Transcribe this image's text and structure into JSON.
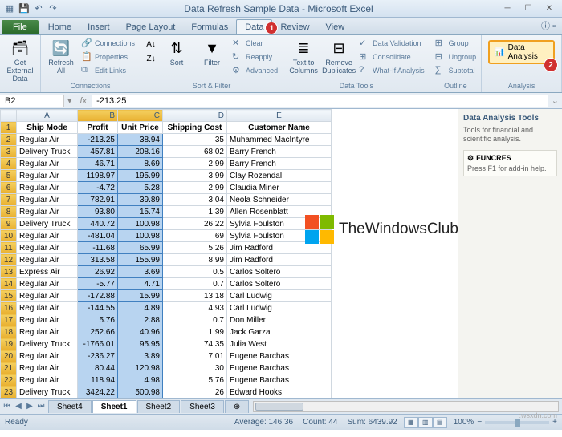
{
  "title": "Data Refresh Sample Data - Microsoft Excel",
  "tabs": {
    "file": "File",
    "home": "Home",
    "insert": "Insert",
    "pagelayout": "Page Layout",
    "formulas": "Formulas",
    "data": "Data",
    "review": "Review",
    "view": "View"
  },
  "badges": {
    "data": "1",
    "analysis": "2"
  },
  "ribbon": {
    "getdata": "Get External Data",
    "refresh": "Refresh All",
    "connections_lbl": "Connections",
    "connections": "Connections",
    "properties": "Properties",
    "editlinks": "Edit Links",
    "sort": "Sort",
    "filter": "Filter",
    "sortfilter": "Sort & Filter",
    "clear": "Clear",
    "reapply": "Reapply",
    "advanced": "Advanced",
    "ttc": "Text to Columns",
    "remdup": "Remove Duplicates",
    "datatools": "Data Tools",
    "validation": "Data Validation",
    "consolidate": "Consolidate",
    "whatif": "What-If Analysis",
    "group": "Group",
    "ungroup": "Ungroup",
    "subtotal": "Subtotal",
    "outline": "Outline",
    "dataanalysis": "Data Analysis",
    "analysis": "Analysis"
  },
  "namebox": "B2",
  "formula": "-213.25",
  "columns": [
    "A",
    "B",
    "C",
    "D",
    "E"
  ],
  "headers": {
    "A": "Ship Mode",
    "B": "Profit",
    "C": "Unit Price",
    "D": "Shipping Cost",
    "E": "Customer Name"
  },
  "rows": [
    {
      "n": "2",
      "A": "Regular Air",
      "B": "-213.25",
      "C": "38.94",
      "D": "35",
      "E": "Muhammed MacIntyre"
    },
    {
      "n": "3",
      "A": "Delivery Truck",
      "B": "457.81",
      "C": "208.16",
      "D": "68.02",
      "E": "Barry French"
    },
    {
      "n": "4",
      "A": "Regular Air",
      "B": "46.71",
      "C": "8.69",
      "D": "2.99",
      "E": "Barry French"
    },
    {
      "n": "5",
      "A": "Regular Air",
      "B": "1198.97",
      "C": "195.99",
      "D": "3.99",
      "E": "Clay Rozendal"
    },
    {
      "n": "6",
      "A": "Regular Air",
      "B": "-4.72",
      "C": "5.28",
      "D": "2.99",
      "E": "Claudia Miner"
    },
    {
      "n": "7",
      "A": "Regular Air",
      "B": "782.91",
      "C": "39.89",
      "D": "3.04",
      "E": "Neola Schneider"
    },
    {
      "n": "8",
      "A": "Regular Air",
      "B": "93.80",
      "C": "15.74",
      "D": "1.39",
      "E": "Allen Rosenblatt"
    },
    {
      "n": "9",
      "A": "Delivery Truck",
      "B": "440.72",
      "C": "100.98",
      "D": "26.22",
      "E": "Sylvia Foulston"
    },
    {
      "n": "10",
      "A": "Regular Air",
      "B": "-481.04",
      "C": "100.98",
      "D": "69",
      "E": "Sylvia Foulston"
    },
    {
      "n": "11",
      "A": "Regular Air",
      "B": "-11.68",
      "C": "65.99",
      "D": "5.26",
      "E": "Jim Radford"
    },
    {
      "n": "12",
      "A": "Regular Air",
      "B": "313.58",
      "C": "155.99",
      "D": "8.99",
      "E": "Jim Radford"
    },
    {
      "n": "13",
      "A": "Express Air",
      "B": "26.92",
      "C": "3.69",
      "D": "0.5",
      "E": "Carlos Soltero"
    },
    {
      "n": "14",
      "A": "Regular Air",
      "B": "-5.77",
      "C": "4.71",
      "D": "0.7",
      "E": "Carlos Soltero"
    },
    {
      "n": "15",
      "A": "Regular Air",
      "B": "-172.88",
      "C": "15.99",
      "D": "13.18",
      "E": "Carl Ludwig"
    },
    {
      "n": "16",
      "A": "Regular Air",
      "B": "-144.55",
      "C": "4.89",
      "D": "4.93",
      "E": "Carl Ludwig"
    },
    {
      "n": "17",
      "A": "Regular Air",
      "B": "5.76",
      "C": "2.88",
      "D": "0.7",
      "E": "Don Miller"
    },
    {
      "n": "18",
      "A": "Regular Air",
      "B": "252.66",
      "C": "40.96",
      "D": "1.99",
      "E": "Jack Garza"
    },
    {
      "n": "19",
      "A": "Delivery Truck",
      "B": "-1766.01",
      "C": "95.95",
      "D": "74.35",
      "E": "Julia West"
    },
    {
      "n": "20",
      "A": "Regular Air",
      "B": "-236.27",
      "C": "3.89",
      "D": "7.01",
      "E": "Eugene Barchas"
    },
    {
      "n": "21",
      "A": "Regular Air",
      "B": "80.44",
      "C": "120.98",
      "D": "30",
      "E": "Eugene Barchas"
    },
    {
      "n": "22",
      "A": "Regular Air",
      "B": "118.94",
      "C": "4.98",
      "D": "5.76",
      "E": "Eugene Barchas"
    },
    {
      "n": "23",
      "A": "Delivery Truck",
      "B": "3424.22",
      "C": "500.98",
      "D": "26",
      "E": "Edward Hooks"
    }
  ],
  "info": {
    "title": "Data Analysis Tools",
    "desc": "Tools for financial and scientific analysis.",
    "funcres": "FUNCRES",
    "funcres_desc": "Press F1 for add-in help."
  },
  "sheets": [
    "Sheet4",
    "Sheet1",
    "Sheet2",
    "Sheet3"
  ],
  "status": {
    "ready": "Ready",
    "avg": "Average: 146.36",
    "count": "Count: 44",
    "sum": "Sum: 6439.92",
    "zoom": "100%"
  },
  "watermark": "TheWindowsClub",
  "attribution": ":wsxdn.com"
}
